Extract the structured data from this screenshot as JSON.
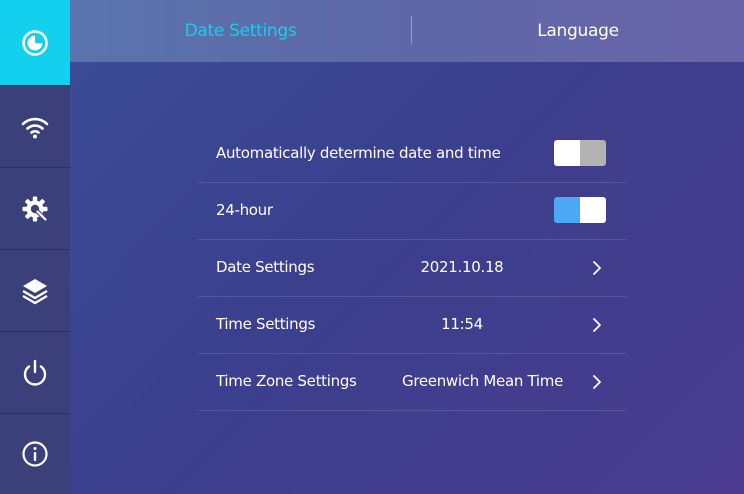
{
  "tabs": [
    {
      "label": "Date Settings",
      "active": true
    },
    {
      "label": "Language",
      "active": false
    }
  ],
  "sidebar": {
    "items": [
      {
        "icon": "clock-icon",
        "active": true
      },
      {
        "icon": "wifi-icon",
        "active": false
      },
      {
        "icon": "gear-icon",
        "active": false
      },
      {
        "icon": "layers-icon",
        "active": false
      },
      {
        "icon": "power-icon",
        "active": false
      },
      {
        "icon": "info-icon",
        "active": false
      }
    ]
  },
  "settings": {
    "auto_datetime": {
      "label": "Automatically determine date and time",
      "enabled": false
    },
    "hour24": {
      "label": "24-hour",
      "enabled": true
    },
    "date": {
      "label": "Date Settings",
      "value": "2021.10.18"
    },
    "time": {
      "label": "Time Settings",
      "value": "11:54"
    },
    "timezone": {
      "label": "Time Zone Settings",
      "value": "Greenwich Mean Time"
    }
  },
  "colors": {
    "accent": "#12d0ee",
    "toggle_on": "#4aa8f5",
    "toggle_off": "#b3b3b3",
    "sidebar_bg": "#3b3f7a"
  }
}
